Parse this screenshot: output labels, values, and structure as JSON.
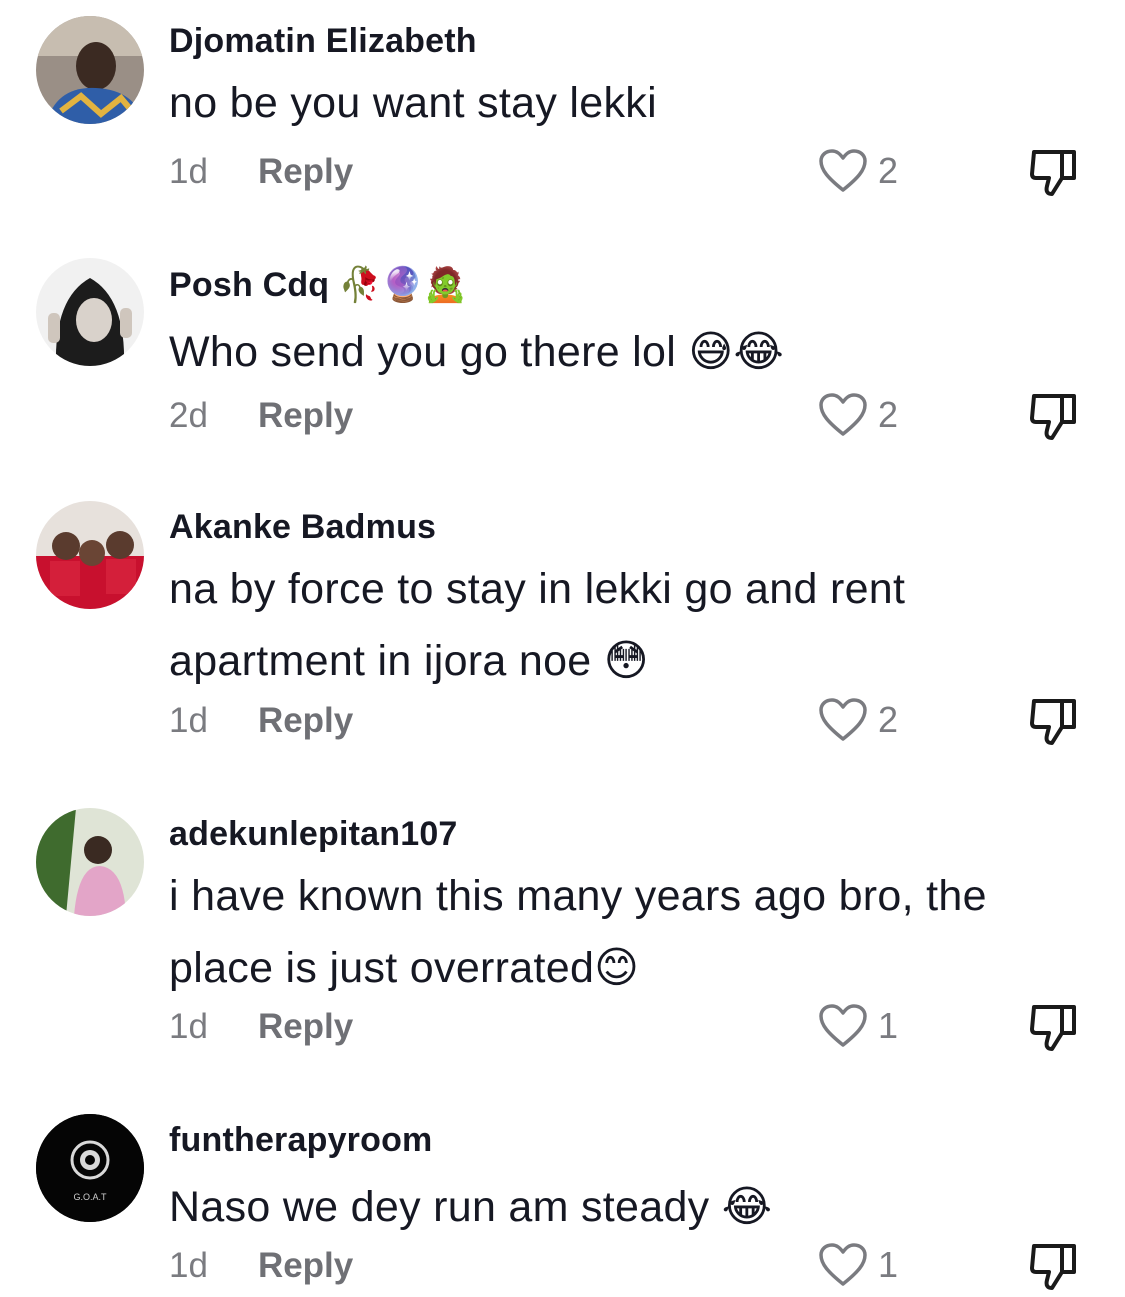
{
  "comments": [
    {
      "author": "Djomatin Elizabeth",
      "author_emoji": "",
      "text": "no be you want stay lekki",
      "text_emoji": "",
      "age": "1d",
      "reply_label": "Reply",
      "likes": "2"
    },
    {
      "author": "Posh Cdq",
      "author_emoji": "🥀🔮🧟",
      "text": "Who send you go there lol",
      "text_emoji": "😅😂",
      "age": "2d",
      "reply_label": "Reply",
      "likes": "2"
    },
    {
      "author": "Akanke Badmus",
      "author_emoji": "",
      "text": "na by force to stay in lekki go and rent apartment in ijora noe",
      "text_emoji": "😳",
      "age": "1d",
      "reply_label": "Reply",
      "likes": "2"
    },
    {
      "author": "adekunlepitan107",
      "author_emoji": "",
      "text": "i have known this many years ago bro, the place is just overrated",
      "text_emoji": "😊",
      "age": "1d",
      "reply_label": "Reply",
      "likes": "1"
    },
    {
      "author": "funtherapyroom",
      "author_emoji": "",
      "text": "Naso we dey run am steady",
      "text_emoji": "😂",
      "age": "1d",
      "reply_label": "Reply",
      "likes": "1",
      "avatar_text": "G.O.A.T"
    }
  ],
  "icons": {
    "like": "heart-outline-icon",
    "dislike": "thumbs-down-icon"
  }
}
